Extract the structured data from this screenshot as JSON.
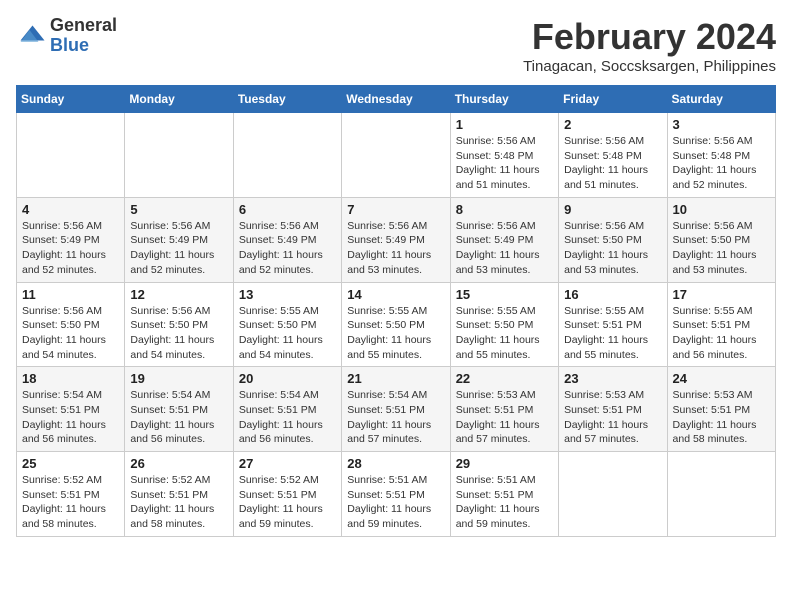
{
  "logo": {
    "general": "General",
    "blue": "Blue"
  },
  "header": {
    "month": "February 2024",
    "location": "Tinagacan, Soccsksargen, Philippines"
  },
  "weekdays": [
    "Sunday",
    "Monday",
    "Tuesday",
    "Wednesday",
    "Thursday",
    "Friday",
    "Saturday"
  ],
  "weeks": [
    [
      {
        "day": "",
        "info": ""
      },
      {
        "day": "",
        "info": ""
      },
      {
        "day": "",
        "info": ""
      },
      {
        "day": "",
        "info": ""
      },
      {
        "day": "1",
        "info": "Sunrise: 5:56 AM\nSunset: 5:48 PM\nDaylight: 11 hours and 51 minutes."
      },
      {
        "day": "2",
        "info": "Sunrise: 5:56 AM\nSunset: 5:48 PM\nDaylight: 11 hours and 51 minutes."
      },
      {
        "day": "3",
        "info": "Sunrise: 5:56 AM\nSunset: 5:48 PM\nDaylight: 11 hours and 52 minutes."
      }
    ],
    [
      {
        "day": "4",
        "info": "Sunrise: 5:56 AM\nSunset: 5:49 PM\nDaylight: 11 hours and 52 minutes."
      },
      {
        "day": "5",
        "info": "Sunrise: 5:56 AM\nSunset: 5:49 PM\nDaylight: 11 hours and 52 minutes."
      },
      {
        "day": "6",
        "info": "Sunrise: 5:56 AM\nSunset: 5:49 PM\nDaylight: 11 hours and 52 minutes."
      },
      {
        "day": "7",
        "info": "Sunrise: 5:56 AM\nSunset: 5:49 PM\nDaylight: 11 hours and 53 minutes."
      },
      {
        "day": "8",
        "info": "Sunrise: 5:56 AM\nSunset: 5:49 PM\nDaylight: 11 hours and 53 minutes."
      },
      {
        "day": "9",
        "info": "Sunrise: 5:56 AM\nSunset: 5:50 PM\nDaylight: 11 hours and 53 minutes."
      },
      {
        "day": "10",
        "info": "Sunrise: 5:56 AM\nSunset: 5:50 PM\nDaylight: 11 hours and 53 minutes."
      }
    ],
    [
      {
        "day": "11",
        "info": "Sunrise: 5:56 AM\nSunset: 5:50 PM\nDaylight: 11 hours and 54 minutes."
      },
      {
        "day": "12",
        "info": "Sunrise: 5:56 AM\nSunset: 5:50 PM\nDaylight: 11 hours and 54 minutes."
      },
      {
        "day": "13",
        "info": "Sunrise: 5:55 AM\nSunset: 5:50 PM\nDaylight: 11 hours and 54 minutes."
      },
      {
        "day": "14",
        "info": "Sunrise: 5:55 AM\nSunset: 5:50 PM\nDaylight: 11 hours and 55 minutes."
      },
      {
        "day": "15",
        "info": "Sunrise: 5:55 AM\nSunset: 5:50 PM\nDaylight: 11 hours and 55 minutes."
      },
      {
        "day": "16",
        "info": "Sunrise: 5:55 AM\nSunset: 5:51 PM\nDaylight: 11 hours and 55 minutes."
      },
      {
        "day": "17",
        "info": "Sunrise: 5:55 AM\nSunset: 5:51 PM\nDaylight: 11 hours and 56 minutes."
      }
    ],
    [
      {
        "day": "18",
        "info": "Sunrise: 5:54 AM\nSunset: 5:51 PM\nDaylight: 11 hours and 56 minutes."
      },
      {
        "day": "19",
        "info": "Sunrise: 5:54 AM\nSunset: 5:51 PM\nDaylight: 11 hours and 56 minutes."
      },
      {
        "day": "20",
        "info": "Sunrise: 5:54 AM\nSunset: 5:51 PM\nDaylight: 11 hours and 56 minutes."
      },
      {
        "day": "21",
        "info": "Sunrise: 5:54 AM\nSunset: 5:51 PM\nDaylight: 11 hours and 57 minutes."
      },
      {
        "day": "22",
        "info": "Sunrise: 5:53 AM\nSunset: 5:51 PM\nDaylight: 11 hours and 57 minutes."
      },
      {
        "day": "23",
        "info": "Sunrise: 5:53 AM\nSunset: 5:51 PM\nDaylight: 11 hours and 57 minutes."
      },
      {
        "day": "24",
        "info": "Sunrise: 5:53 AM\nSunset: 5:51 PM\nDaylight: 11 hours and 58 minutes."
      }
    ],
    [
      {
        "day": "25",
        "info": "Sunrise: 5:52 AM\nSunset: 5:51 PM\nDaylight: 11 hours and 58 minutes."
      },
      {
        "day": "26",
        "info": "Sunrise: 5:52 AM\nSunset: 5:51 PM\nDaylight: 11 hours and 58 minutes."
      },
      {
        "day": "27",
        "info": "Sunrise: 5:52 AM\nSunset: 5:51 PM\nDaylight: 11 hours and 59 minutes."
      },
      {
        "day": "28",
        "info": "Sunrise: 5:51 AM\nSunset: 5:51 PM\nDaylight: 11 hours and 59 minutes."
      },
      {
        "day": "29",
        "info": "Sunrise: 5:51 AM\nSunset: 5:51 PM\nDaylight: 11 hours and 59 minutes."
      },
      {
        "day": "",
        "info": ""
      },
      {
        "day": "",
        "info": ""
      }
    ]
  ]
}
